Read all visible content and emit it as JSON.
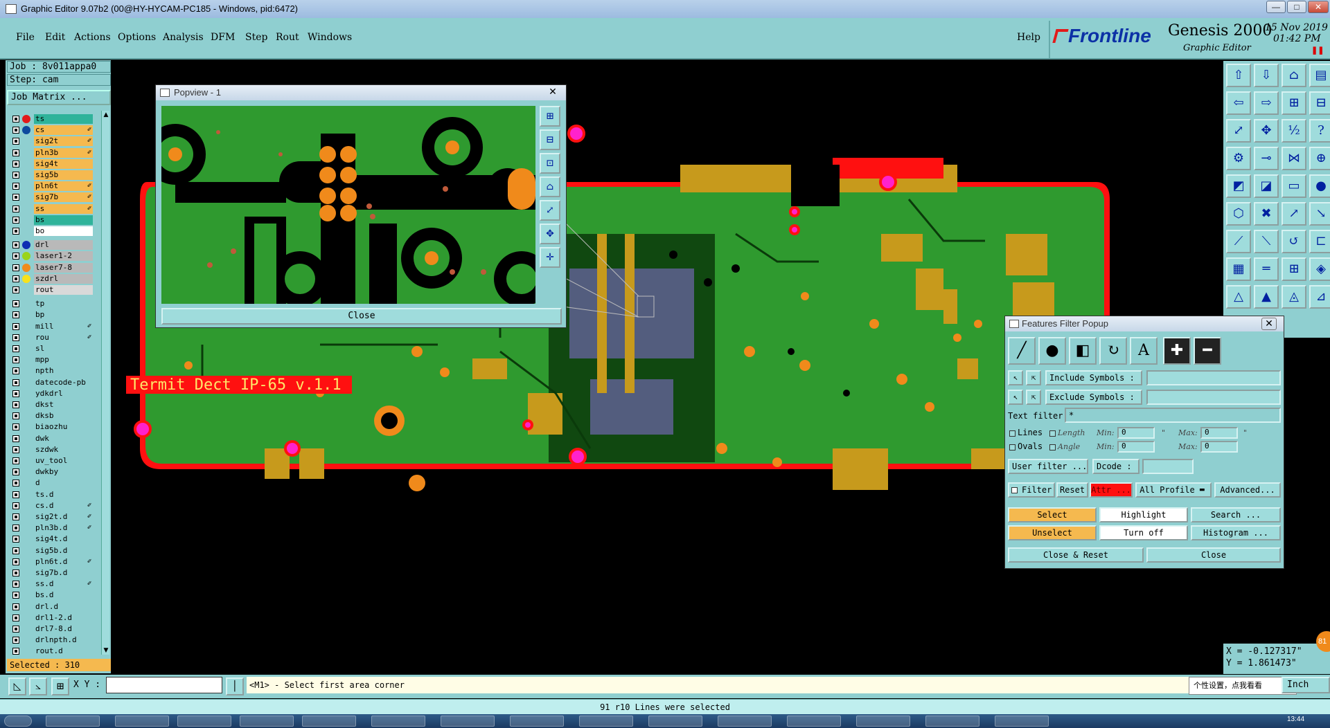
{
  "window": {
    "title": "Graphic Editor 9.07b2 (00@HY-HYCAM-PC185 - Windows, pid:6472)",
    "minimize": "—",
    "maximize": "□",
    "close": "✕"
  },
  "menu": {
    "items": [
      "File",
      "Edit",
      "Actions",
      "Options",
      "Analysis",
      "DFM",
      "Step",
      "Rout",
      "Windows"
    ],
    "help": "Help"
  },
  "brand": {
    "company": "Frontline",
    "product": "Genesis 2000",
    "module": "Graphic Editor",
    "date": "15 Nov 2019",
    "time": "01:42 PM",
    "pause_icon": "pause-icon"
  },
  "left": {
    "job": "Job : 8v011appa0",
    "step": "Step: cam",
    "job_matrix": "Job Matrix ...",
    "selected": "Selected : 310",
    "layers": [
      {
        "name": "ts",
        "bg": "#2fb39a",
        "dot": "#e21b1b",
        "flag": ""
      },
      {
        "name": "cs",
        "bg": "#f5b94f",
        "dot": "#0d4a9e",
        "flag": "✐"
      },
      {
        "name": "sig2t",
        "bg": "#f5b94f",
        "dot": "",
        "flag": "✐"
      },
      {
        "name": "pln3b",
        "bg": "#f5b94f",
        "dot": "",
        "flag": "✐"
      },
      {
        "name": "sig4t",
        "bg": "#f5b94f",
        "dot": "",
        "flag": ""
      },
      {
        "name": "sig5b",
        "bg": "#f5b94f",
        "dot": "",
        "flag": ""
      },
      {
        "name": "pln6t",
        "bg": "#f5b94f",
        "dot": "",
        "flag": "✐"
      },
      {
        "name": "sig7b",
        "bg": "#f5b94f",
        "dot": "",
        "flag": "✐"
      },
      {
        "name": "ss",
        "bg": "#f5b94f",
        "dot": "",
        "flag": "✐"
      },
      {
        "name": "bs",
        "bg": "#2fb39a",
        "dot": "",
        "flag": ""
      },
      {
        "name": "bo",
        "bg": "#ffffff",
        "dot": "",
        "flag": ""
      },
      {
        "name": "drl",
        "bg": "#b9b9b9",
        "dot": "#0d2fb3",
        "flag": ""
      },
      {
        "name": "laser1-2",
        "bg": "#b9b9b9",
        "dot": "#9ad41a",
        "flag": ""
      },
      {
        "name": "laser7-8",
        "bg": "#b9b9b9",
        "dot": "#f08a1b",
        "flag": ""
      },
      {
        "name": "szdrl",
        "bg": "#b9b9b9",
        "dot": "#f7e21b",
        "flag": ""
      },
      {
        "name": "rout",
        "bg": "#d9d9d9",
        "dot": "",
        "flag": ""
      },
      {
        "name": "tp",
        "bg": "#8fcfd0",
        "dot": "",
        "flag": ""
      },
      {
        "name": "bp",
        "bg": "#8fcfd0",
        "dot": "",
        "flag": ""
      },
      {
        "name": "mill",
        "bg": "#8fcfd0",
        "dot": "",
        "flag": "✐"
      },
      {
        "name": "rou",
        "bg": "#8fcfd0",
        "dot": "",
        "flag": "✐"
      },
      {
        "name": "sl",
        "bg": "#8fcfd0",
        "dot": "",
        "flag": ""
      },
      {
        "name": "mpp",
        "bg": "#8fcfd0",
        "dot": "",
        "flag": ""
      },
      {
        "name": "npth",
        "bg": "#8fcfd0",
        "dot": "",
        "flag": ""
      },
      {
        "name": "datecode-pb",
        "bg": "#8fcfd0",
        "dot": "",
        "flag": ""
      },
      {
        "name": "ydkdrl",
        "bg": "#8fcfd0",
        "dot": "",
        "flag": ""
      },
      {
        "name": "dkst",
        "bg": "#8fcfd0",
        "dot": "",
        "flag": ""
      },
      {
        "name": "dksb",
        "bg": "#8fcfd0",
        "dot": "",
        "flag": ""
      },
      {
        "name": "biaozhu",
        "bg": "#8fcfd0",
        "dot": "",
        "flag": ""
      },
      {
        "name": "dwk",
        "bg": "#8fcfd0",
        "dot": "",
        "flag": ""
      },
      {
        "name": "szdwk",
        "bg": "#8fcfd0",
        "dot": "",
        "flag": ""
      },
      {
        "name": "uv_tool",
        "bg": "#8fcfd0",
        "dot": "",
        "flag": ""
      },
      {
        "name": "dwkby",
        "bg": "#8fcfd0",
        "dot": "",
        "flag": ""
      },
      {
        "name": "d",
        "bg": "#8fcfd0",
        "dot": "",
        "flag": ""
      },
      {
        "name": "ts.d",
        "bg": "#8fcfd0",
        "dot": "",
        "flag": ""
      },
      {
        "name": "cs.d",
        "bg": "#8fcfd0",
        "dot": "",
        "flag": "✐"
      },
      {
        "name": "sig2t.d",
        "bg": "#8fcfd0",
        "dot": "",
        "flag": "✐"
      },
      {
        "name": "pln3b.d",
        "bg": "#8fcfd0",
        "dot": "",
        "flag": "✐"
      },
      {
        "name": "sig4t.d",
        "bg": "#8fcfd0",
        "dot": "",
        "flag": ""
      },
      {
        "name": "sig5b.d",
        "bg": "#8fcfd0",
        "dot": "",
        "flag": ""
      },
      {
        "name": "pln6t.d",
        "bg": "#8fcfd0",
        "dot": "",
        "flag": "✐"
      },
      {
        "name": "sig7b.d",
        "bg": "#8fcfd0",
        "dot": "",
        "flag": ""
      },
      {
        "name": "ss.d",
        "bg": "#8fcfd0",
        "dot": "",
        "flag": "✐"
      },
      {
        "name": "bs.d",
        "bg": "#8fcfd0",
        "dot": "",
        "flag": ""
      },
      {
        "name": "drl.d",
        "bg": "#8fcfd0",
        "dot": "",
        "flag": ""
      },
      {
        "name": "drl1-2.d",
        "bg": "#8fcfd0",
        "dot": "",
        "flag": ""
      },
      {
        "name": "drl7-8.d",
        "bg": "#8fcfd0",
        "dot": "",
        "flag": ""
      },
      {
        "name": "drlnpth.d",
        "bg": "#8fcfd0",
        "dot": "",
        "flag": ""
      },
      {
        "name": "rout.d",
        "bg": "#8fcfd0",
        "dot": "",
        "flag": ""
      }
    ]
  },
  "board": {
    "silkscreen_text": "Termit Dect IP-65 v.1.1",
    "colors": {
      "copper": "#c79a1c",
      "laminate": "#2f9a2f",
      "outline": "#ff1010",
      "pad": "#f08a1b",
      "via": "#ff22cc",
      "mask": "#000000"
    }
  },
  "popview": {
    "title": "Popview - 1",
    "close_label": "Close"
  },
  "filter": {
    "title": "Features Filter Popup",
    "include_label": "Include Symbols :",
    "exclude_label": "Exclude Symbols :",
    "text_filter_label": "Text filter",
    "text_filter_value": "*",
    "lines_label": "Lines",
    "ovals_label": "Ovals",
    "length_label": "Length",
    "angle_label": "Angle",
    "min_label": "Min:",
    "max_label": "Max:",
    "length_min": "0",
    "length_max": "0",
    "angle_min": "0",
    "angle_max": "0",
    "length_unit": "\"",
    "user_filter": "User filter ...",
    "dcode_label": "Dcode :",
    "filter_label": "Filter",
    "reset": "Reset",
    "attr": "Attr ...",
    "profile": "All Profile",
    "advanced": "Advanced...",
    "select": "Select",
    "highlight": "Highlight",
    "search": "Search ...",
    "unselect": "Unselect",
    "turn_off": "Turn off",
    "histogram": "Histogram ...",
    "close_reset": "Close & Reset",
    "close": "Close"
  },
  "bottom": {
    "xy_label": "X Y :",
    "xy_value": "",
    "prompt": "<M1> - Select first area corner",
    "status": "91 r10 Lines were selected",
    "tooltip": "个性设置，点我看看",
    "unit": "Inch",
    "coord_x": "X = -0.127317\"",
    "coord_y": "Y =  1.861473\"",
    "badge": "81",
    "clock": "13:44"
  }
}
